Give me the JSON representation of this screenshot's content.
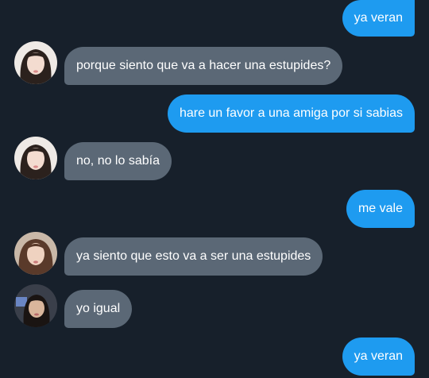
{
  "messages": [
    {
      "side": "out",
      "text": "ya veran"
    },
    {
      "side": "in",
      "text": "porque siento que va a hacer una estupides?",
      "avatar": "avatar-a"
    },
    {
      "side": "out",
      "text": "hare un favor a una amiga por si sabias"
    },
    {
      "side": "in",
      "text": "no, no lo sabía",
      "avatar": "avatar-a"
    },
    {
      "side": "out",
      "text": "me vale"
    },
    {
      "side": "in",
      "text": "ya siento que esto va a ser una estupides",
      "avatar": "avatar-b"
    },
    {
      "side": "in",
      "text": "yo igual",
      "avatar": "avatar-c"
    },
    {
      "side": "out",
      "text": "ya veran"
    }
  ],
  "colors": {
    "background": "#17202b",
    "outgoing_bubble": "#1e9bf0",
    "incoming_bubble": "#5b6876",
    "text": "#ffffff"
  }
}
